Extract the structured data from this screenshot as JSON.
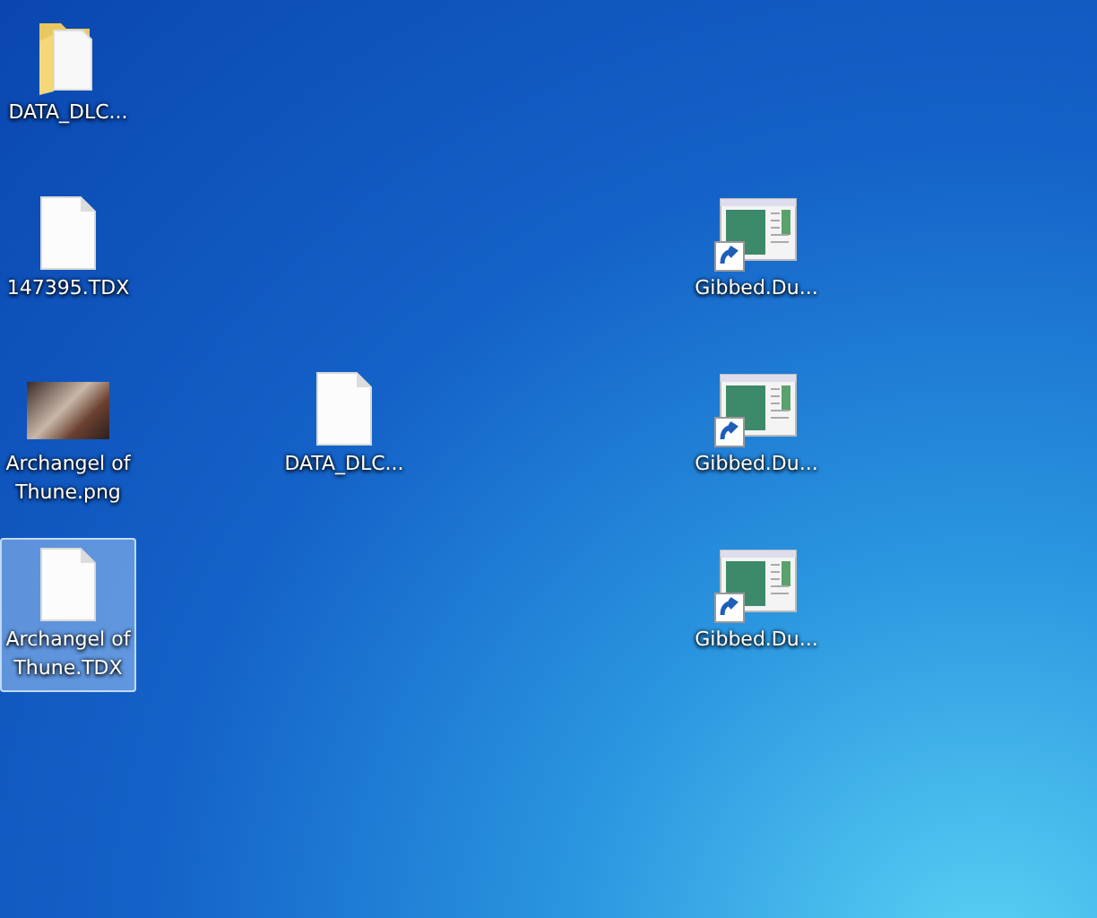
{
  "desktop": {
    "icons": [
      {
        "kind": "folder",
        "label": "DATA_DLC...",
        "selected": false
      },
      {
        "kind": "file",
        "label": "147395.TDX",
        "selected": false
      },
      {
        "kind": "image",
        "label": "Archangel of Thune.png",
        "selected": false
      },
      {
        "kind": "file",
        "label": "Archangel of Thune.TDX",
        "selected": true
      },
      {
        "kind": "file",
        "label": "DATA_DLC...",
        "selected": false
      },
      {
        "kind": "shortcut",
        "label": "Gibbed.Du...",
        "selected": false
      },
      {
        "kind": "shortcut",
        "label": "Gibbed.Du...",
        "selected": false
      },
      {
        "kind": "shortcut",
        "label": "Gibbed.Du...",
        "selected": false
      }
    ]
  }
}
